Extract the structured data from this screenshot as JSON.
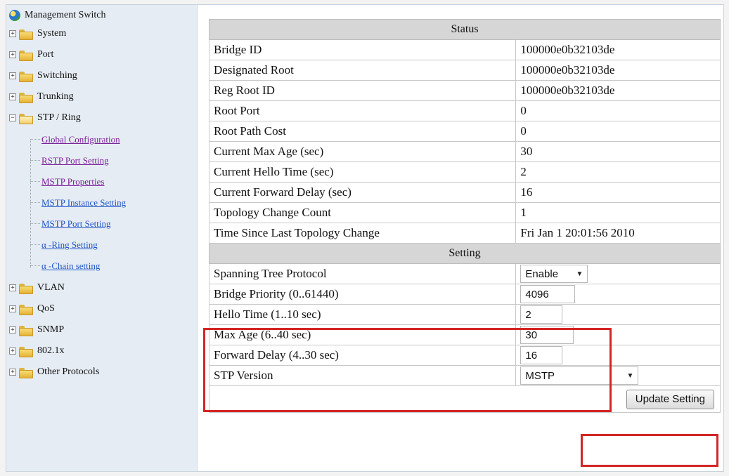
{
  "tree": {
    "root_label": "Management Switch",
    "nodes": [
      {
        "label": "System",
        "expanded": false
      },
      {
        "label": "Port",
        "expanded": false
      },
      {
        "label": "Switching",
        "expanded": false
      },
      {
        "label": "Trunking",
        "expanded": false
      },
      {
        "label": "STP / Ring",
        "expanded": true
      },
      {
        "label": "VLAN",
        "expanded": false
      },
      {
        "label": "QoS",
        "expanded": false
      },
      {
        "label": "SNMP",
        "expanded": false
      },
      {
        "label": "802.1x",
        "expanded": false
      },
      {
        "label": "Other Protocols",
        "expanded": false
      }
    ],
    "stp_children": [
      {
        "label": "Global Configuration",
        "visited": true
      },
      {
        "label": "RSTP Port Setting",
        "visited": true
      },
      {
        "label": "MSTP Properties",
        "visited": true
      },
      {
        "label": "MSTP Instance Setting",
        "visited": false
      },
      {
        "label": "MSTP Port Setting",
        "visited": false
      },
      {
        "label": "α -Ring Setting",
        "visited": false
      },
      {
        "label": "α -Chain setting",
        "visited": false
      }
    ],
    "expand_glyph": "+",
    "collapse_glyph": "−"
  },
  "status": {
    "header": "Status",
    "rows": [
      {
        "label": "Bridge ID",
        "value": "100000e0b32103de"
      },
      {
        "label": "Designated Root",
        "value": "100000e0b32103de"
      },
      {
        "label": "Reg Root ID",
        "value": "100000e0b32103de"
      },
      {
        "label": "Root Port",
        "value": "0"
      },
      {
        "label": "Root Path Cost",
        "value": "0"
      },
      {
        "label": "Current Max Age (sec)",
        "value": "30"
      },
      {
        "label": "Current Hello Time (sec)",
        "value": "2"
      },
      {
        "label": "Current Forward Delay (sec)",
        "value": "16"
      },
      {
        "label": "Topology Change Count",
        "value": "1"
      },
      {
        "label": "Time Since Last Topology Change",
        "value": "Fri Jan 1 20:01:56 2010"
      }
    ]
  },
  "setting": {
    "header": "Setting",
    "spanning_tree_protocol": {
      "label": "Spanning Tree Protocol",
      "value": "Enable"
    },
    "bridge_priority": {
      "label": "Bridge Priority (0..61440)",
      "value": "4096"
    },
    "hello_time": {
      "label": "Hello Time (1..10 sec)",
      "value": "2"
    },
    "max_age": {
      "label": "Max Age (6..40 sec)",
      "value": "30"
    },
    "forward_delay": {
      "label": "Forward Delay (4..30 sec)",
      "value": "16"
    },
    "stp_version": {
      "label": "STP Version",
      "value": "MSTP"
    },
    "update_button": "Update Setting"
  },
  "colors": {
    "highlight": "#d42525",
    "link": "#1f55c9",
    "visited_link": "#7a1f9a",
    "section_header_bg": "#d6d6d6",
    "tree_bg": "#e6ecf3"
  }
}
